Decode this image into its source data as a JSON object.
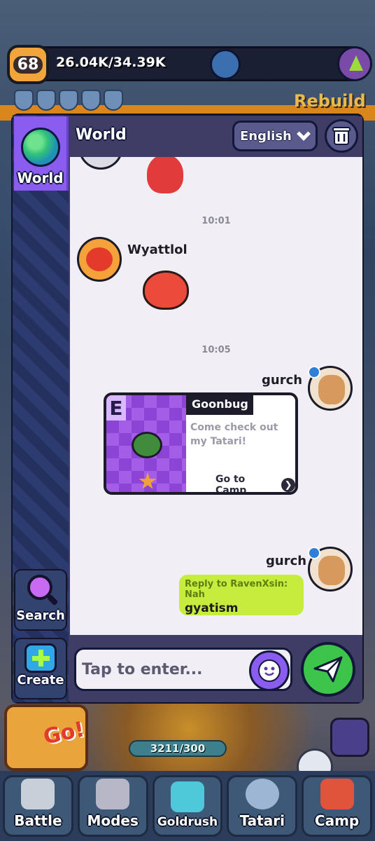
{
  "hud": {
    "level": "68",
    "xp": "26.04K/34.39K",
    "rebuild_label": "Rebuild",
    "progress_text": "3211/300"
  },
  "bottom_nav": [
    {
      "label": "Battle",
      "icon": "swords-icon"
    },
    {
      "label": "Modes",
      "icon": "gamepad-icon"
    },
    {
      "label": "Goldrush",
      "icon": "dice-icon"
    },
    {
      "label": "Tatari",
      "icon": "tatari-icon"
    },
    {
      "label": "Camp",
      "icon": "tent-icon"
    }
  ],
  "chat": {
    "title": "World",
    "language": "English",
    "sidebar": {
      "world_label": "World",
      "search_label": "Search",
      "create_label": "Create"
    },
    "messages": {
      "time_1": "10:01",
      "sender_1": "Wyattlol",
      "time_2": "10:05",
      "sender_2": "gurch",
      "card": {
        "rank": "E",
        "name": "Goonbug",
        "text": "Come check out my Tatari!",
        "link": "Go to Camp"
      },
      "sender_3": "gurch",
      "reply_quote": "Reply to RavenXsin: Nah",
      "reply_text": "gyatism"
    },
    "input": {
      "placeholder": "Tap to enter..."
    }
  },
  "colors": {
    "panel": "#3f3d66",
    "accent_purple": "#8a5cf0",
    "send_green": "#3dc44a",
    "reply_bubble": "#c6ec3d"
  }
}
